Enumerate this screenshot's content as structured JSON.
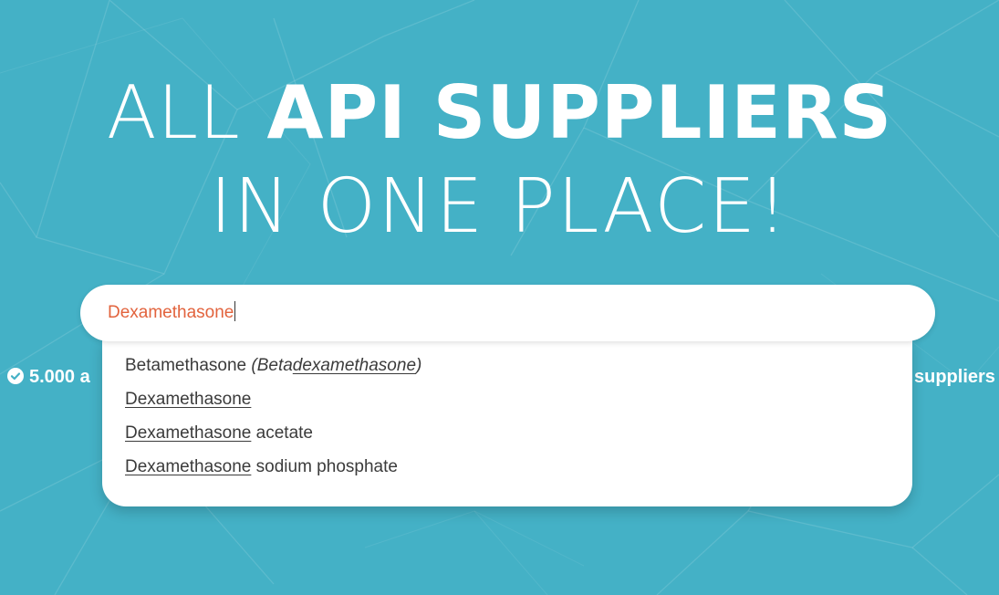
{
  "hero": {
    "line1_thin": "ALL",
    "line1_bold": "API SUPPLIERS",
    "line2": "IN ONE PLACE!"
  },
  "search": {
    "value": "Dexamethasone"
  },
  "suggestions": [
    {
      "plain": "Betamethasone",
      "alias_open": "(Beta",
      "alias_match": "dexamethasone",
      "alias_close": ")"
    },
    {
      "match": "Dexamethasone"
    },
    {
      "match": "Dexamethasone",
      "suffix": "acetate"
    },
    {
      "match": "Dexamethasone",
      "suffix": "sodium phosphate"
    }
  ],
  "stats": {
    "left_text": "5.000 a",
    "right_text": "suppliers"
  },
  "icons": {
    "stat_icon": "check-circle-icon"
  },
  "colors": {
    "background": "#44b1c6",
    "search_text": "#e2633d",
    "suggestion_text": "#3b3b3b"
  }
}
